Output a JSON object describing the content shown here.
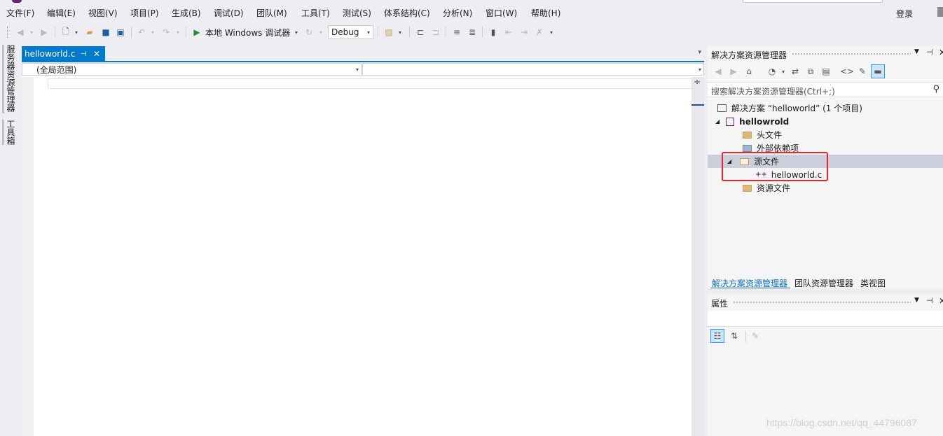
{
  "menu": [
    "文件(F)",
    "编辑(E)",
    "视图(V)",
    "项目(P)",
    "生成(B)",
    "调试(D)",
    "团队(M)",
    "工具(T)",
    "测试(S)",
    "体系结构(C)",
    "分析(N)",
    "窗口(W)",
    "帮助(H)"
  ],
  "account": {
    "login_label": "登录"
  },
  "toolbar": {
    "debugger_label": "本地 Windows 调试器",
    "config_value": "Debug"
  },
  "left_sidebar": {
    "tabs": [
      "服务器资源管理器",
      "工具箱"
    ]
  },
  "editor": {
    "tab_title": "helloworld.c",
    "tab_pin": "⊣",
    "tab_close": "✕",
    "scope_value": "(全局范围)",
    "member_value": ""
  },
  "solution_explorer": {
    "title": "解决方案资源管理器",
    "search_placeholder": "搜索解决方案资源管理器(Ctrl+;)",
    "solution_label": "解决方案 “helloworld” (1 个项目)",
    "project_label": "hellowrold",
    "items": {
      "headers": "头文件",
      "external": "外部依赖项",
      "sources": "源文件",
      "source_file": "helloworld.c",
      "resources": "资源文件"
    },
    "bottom_tabs": [
      "解决方案资源管理器",
      "团队资源管理器",
      "类视图"
    ]
  },
  "properties": {
    "title": "属性"
  },
  "watermark": "https://blog.csdn.net/qq_44796087",
  "colors": {
    "accent": "#007acc",
    "highlight": "#e8262b",
    "selection": "#cccedb"
  }
}
